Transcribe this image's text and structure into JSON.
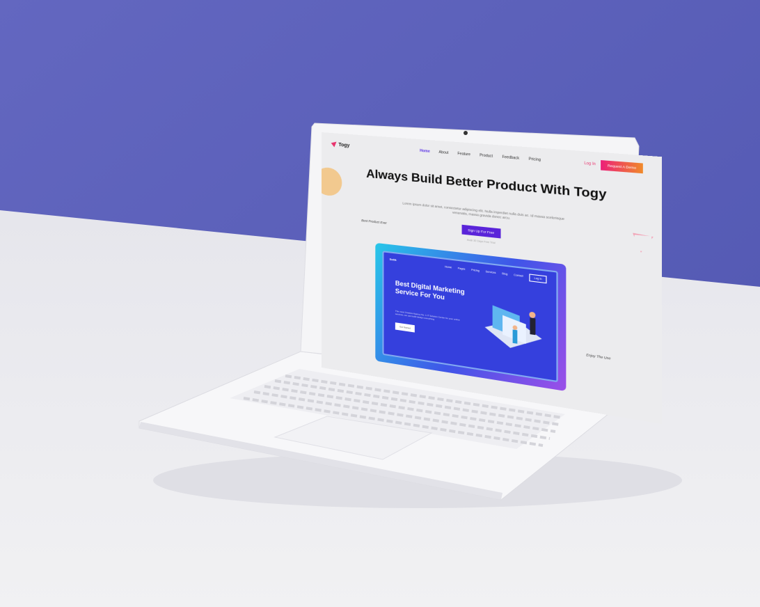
{
  "site": {
    "logo": "Togy",
    "nav": [
      "Home",
      "About",
      "Feature",
      "Product",
      "Feedback",
      "Pricing"
    ],
    "login": "Log In",
    "demo_button": "Request A Demo",
    "headline": "Always Build Better Product With Togy",
    "lead": "Lorem ipsum dolor sit amet, consectetur adipiscing elit. Nulla imperdiet nulla duis ac. Id massa scelerisque venenatis, massa gravida donec arcu.",
    "cta": "Sign Up For Free",
    "trial": "Avail 30 Days Free Trial",
    "note_left": "Best Product Ever",
    "note_right": "Enjoy The Use"
  },
  "preview": {
    "logo": "Sotik",
    "nav": [
      "Home",
      "Pages",
      "Pricing",
      "Services",
      "Blog",
      "Contact"
    ],
    "login": "Log In",
    "headline": "Best Digital Marketing Service For You",
    "text": "The most Creative Agency No. 1 IT Solution Center for your online services, we can build design everything.",
    "button": "Get Started"
  }
}
